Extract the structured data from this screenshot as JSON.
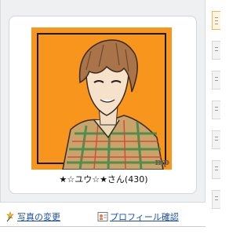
{
  "profile": {
    "name": "★☆ユウ☆★さん(430)",
    "watermark": "mp"
  },
  "links": {
    "change_photo": "写真の変更",
    "confirm_profile": "プロフィール確認"
  },
  "colors": {
    "photo_bg": "#f7951d",
    "link": "#1a4ea8",
    "panel_bg": "#eef0f2"
  },
  "icons": {
    "change_photo": "wand-sparkle-icon",
    "confirm_profile": "profile-card-icon"
  }
}
